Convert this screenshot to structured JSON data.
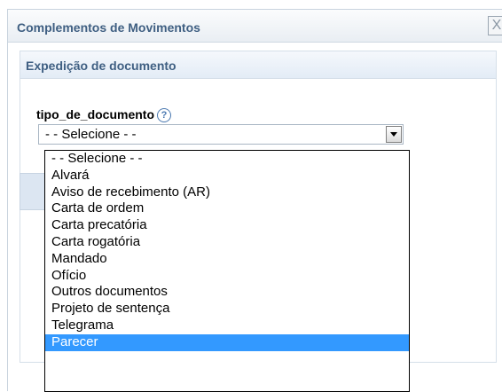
{
  "dialog": {
    "title": "Complementos de Movimentos",
    "close_label": "X"
  },
  "panel": {
    "title": "Expedição de documento"
  },
  "field": {
    "label": "tipo_de_documento",
    "help": "?",
    "selected": "- - Selecione - -"
  },
  "dropdown": {
    "options": [
      "- - Selecione - -",
      "Alvará",
      "Aviso de recebimento (AR)",
      "Carta de ordem",
      "Carta precatória",
      "Carta rogatória",
      "Mandado",
      "Ofício",
      "Outros documentos",
      "Projeto de sentença",
      "Telegrama",
      "Parecer"
    ],
    "highlighted_index": 11
  }
}
